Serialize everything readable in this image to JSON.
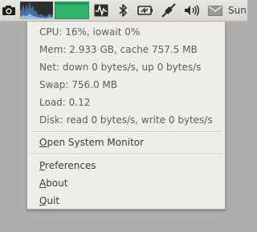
{
  "panel": {
    "clock_text": "Sun",
    "icons": [
      "camera-icon",
      "system-monitor-graph",
      "network-graph",
      "waveform-icon",
      "bluetooth-icon",
      "battery-icon",
      "network-connection-icon",
      "volume-icon",
      "mail-icon"
    ],
    "colors": {
      "panel_bg": "#dedbd6",
      "cpu_graph_bg": "#2e2e2e",
      "cpu_graph_fill": "#4a6ea9",
      "net_graph_fill": "#33b36a"
    }
  },
  "menu": {
    "stats": {
      "cpu": "CPU: 16%, iowait 0%",
      "mem": "Mem: 2.933 GB, cache 757.5 MB",
      "net": "Net: down 0 bytes/s, up 0 bytes/s",
      "swap": "Swap: 756.0 MB",
      "load": "Load: 0.12",
      "disk": "Disk: read 0 bytes/s, write 0 bytes/s"
    },
    "open_monitor": {
      "mnemonic": "O",
      "rest": "pen System Monitor"
    },
    "preferences": {
      "mnemonic": "P",
      "rest": "references"
    },
    "about": {
      "mnemonic": "A",
      "rest": "bout"
    },
    "quit": {
      "mnemonic": "Q",
      "rest": "uit"
    }
  }
}
